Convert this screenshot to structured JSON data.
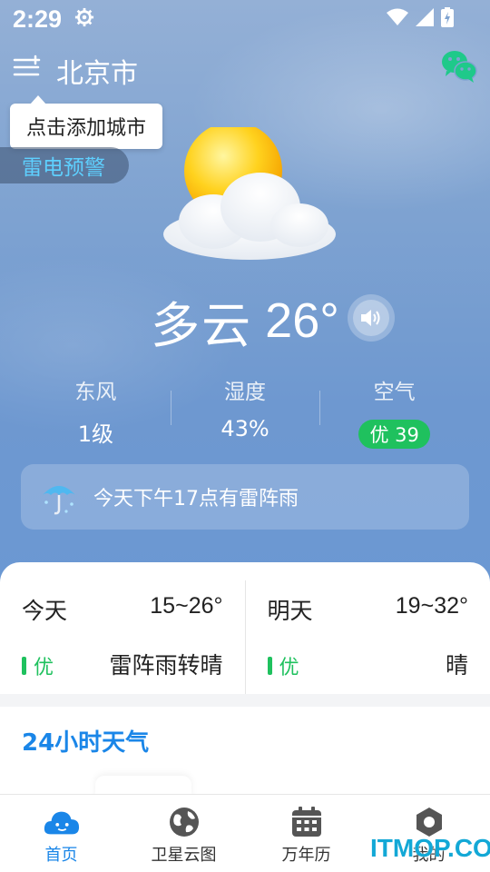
{
  "status_bar": {
    "time": "2:29"
  },
  "header": {
    "city": "北京市"
  },
  "tooltip": {
    "text": "点击添加城市"
  },
  "alert": {
    "text": "雷电预警"
  },
  "current": {
    "condition": "多云",
    "temperature": "26°"
  },
  "stats": [
    {
      "label": "东风",
      "value": "1级"
    },
    {
      "label": "湿度",
      "value": "43%"
    },
    {
      "label": "空气",
      "value": "优 39"
    }
  ],
  "notice": {
    "text": "今天下午17点有雷阵雨"
  },
  "forecast": [
    {
      "day": "今天",
      "range": "15~26°",
      "aqi": "优",
      "desc": "雷阵雨转晴"
    },
    {
      "day": "明天",
      "range": "19~32°",
      "aqi": "优",
      "desc": "晴"
    }
  ],
  "section": {
    "hourly_title": "24小时天气"
  },
  "nav": [
    {
      "label": "首页",
      "icon": "cloud-face-icon"
    },
    {
      "label": "卫星云图",
      "icon": "globe-icon"
    },
    {
      "label": "万年历",
      "icon": "calendar-icon"
    },
    {
      "label": "我的",
      "icon": "hexagon-icon"
    }
  ],
  "watermark": {
    "text": "ITMOP.COM"
  },
  "colors": {
    "accent": "#1a86e8",
    "aqi_good": "#1fc15e",
    "alert_text": "#5ed0ff"
  }
}
